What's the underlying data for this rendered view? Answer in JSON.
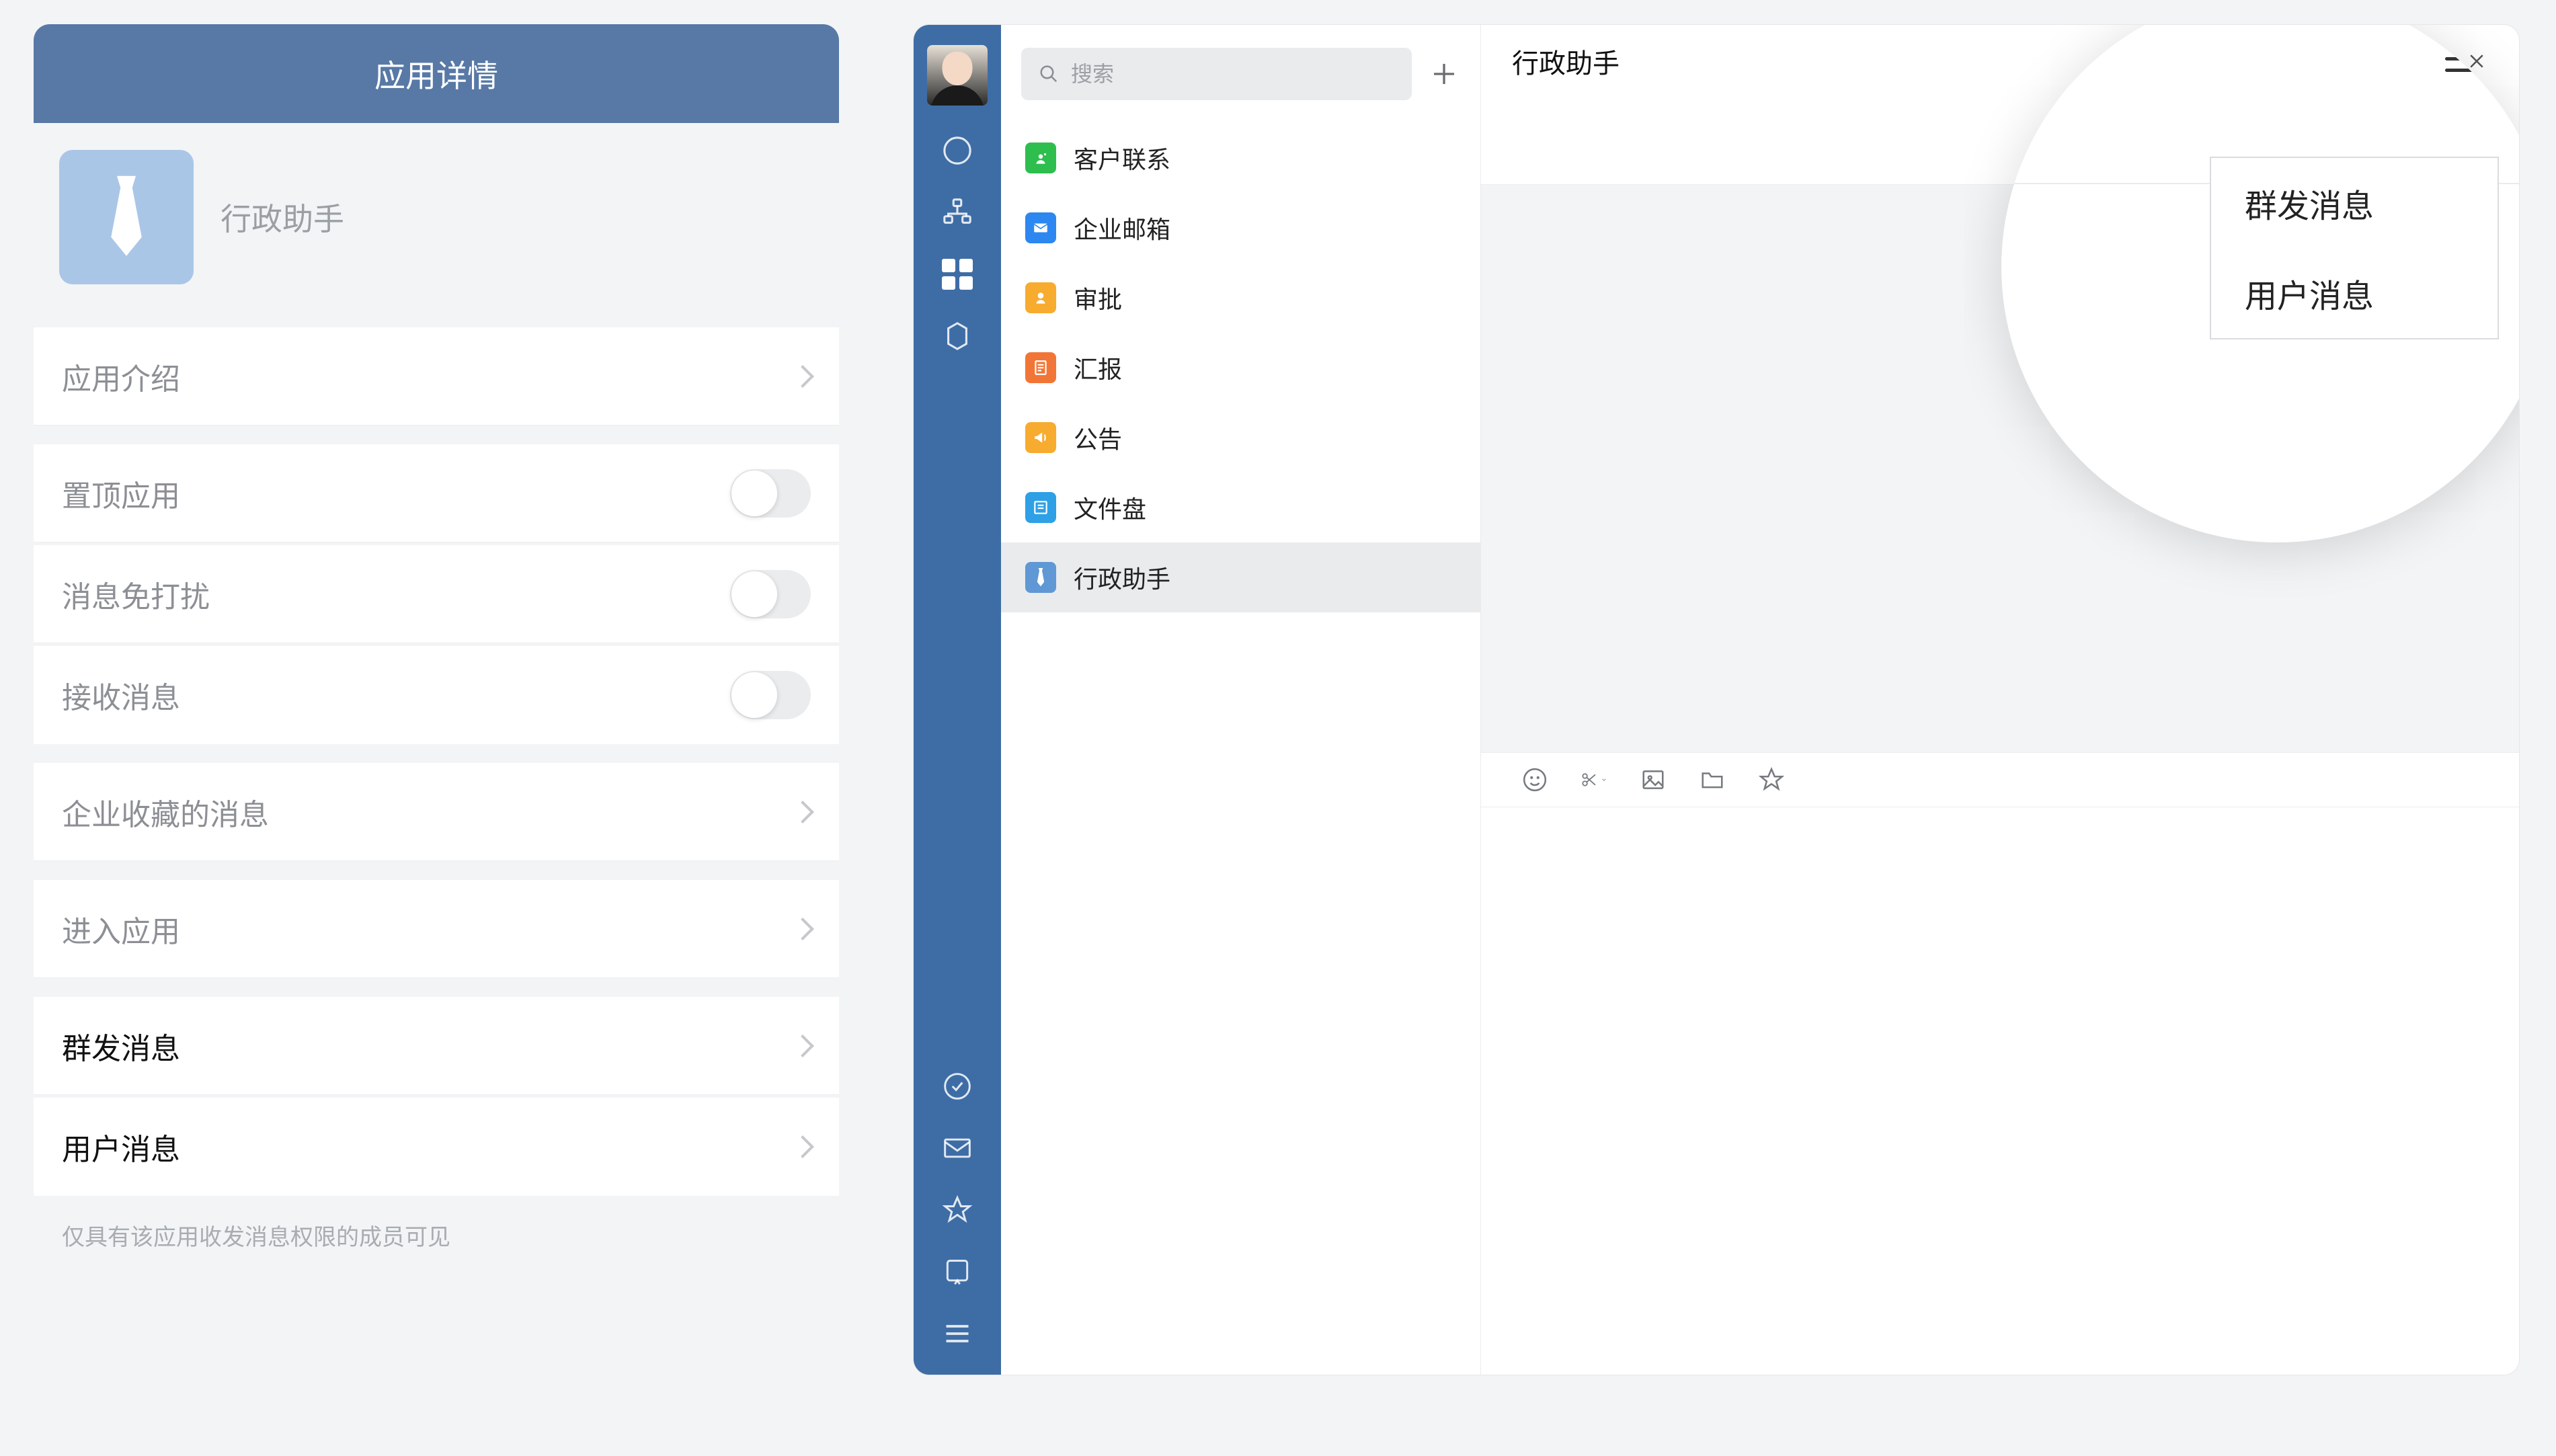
{
  "left": {
    "title": "应用详情",
    "app_name": "行政助手",
    "rows": {
      "about": "应用介绍",
      "pin": "置顶应用",
      "dnd": "消息免打扰",
      "receive": "接收消息",
      "collected": "企业收藏的消息",
      "open": "进入应用",
      "broadcast": "群发消息",
      "user_msg": "用户消息"
    },
    "hint": "仅具有该应用收发消息权限的成员可见"
  },
  "right": {
    "search_placeholder": "搜索",
    "apps": [
      {
        "label": "客户联系",
        "color": "#2dbe4e",
        "iconName": "contact-icon"
      },
      {
        "label": "企业邮箱",
        "color": "#2d87f0",
        "iconName": "mail-icon"
      },
      {
        "label": "审批",
        "color": "#f7ab2f",
        "iconName": "approve-icon"
      },
      {
        "label": "汇报",
        "color": "#f17536",
        "iconName": "report-icon"
      },
      {
        "label": "公告",
        "color": "#f7ab2f",
        "iconName": "announce-icon"
      },
      {
        "label": "文件盘",
        "color": "#2ea0e6",
        "iconName": "filedisk-icon"
      },
      {
        "label": "行政助手",
        "color": "#5f98d5",
        "iconName": "tie-icon",
        "active": true
      }
    ],
    "main_title": "行政助手",
    "menu": {
      "broadcast": "群发消息",
      "user_msg": "用户消息"
    }
  }
}
